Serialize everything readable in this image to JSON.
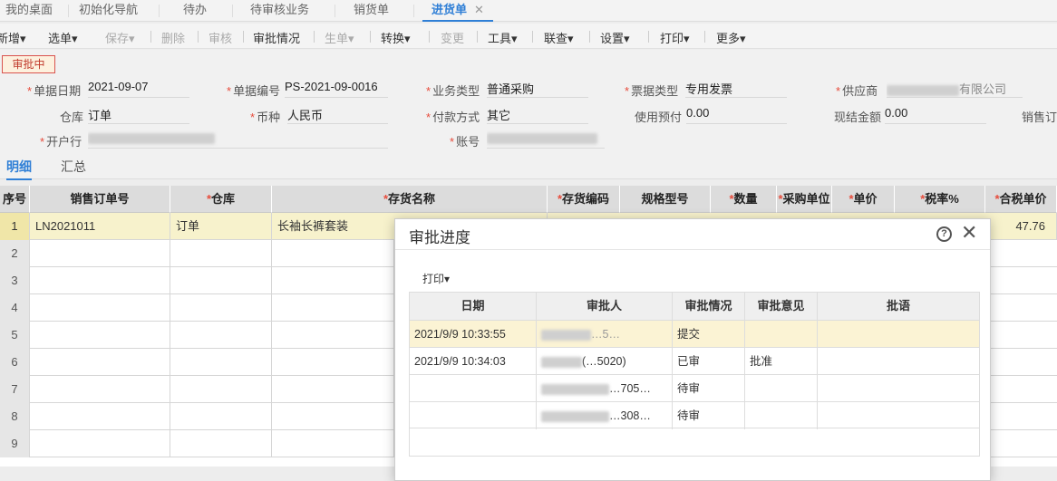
{
  "tabs": [
    {
      "label": "我的桌面"
    },
    {
      "label": "初始化导航"
    },
    {
      "label": "待办"
    },
    {
      "label": "待审核业务"
    },
    {
      "label": "销货单"
    },
    {
      "label": "进货单",
      "close": "✕"
    }
  ],
  "toolbar": {
    "items": [
      "新增",
      "选单",
      "保存",
      "删除",
      "审核",
      "审批情况",
      "生单",
      "转换",
      "变更",
      "工具",
      "联查",
      "设置",
      "打印",
      "更多"
    ],
    "caret": "▾"
  },
  "status_badge": "审批中",
  "form": {
    "date_label": "单据日期",
    "date_value": "2021-09-07",
    "no_label": "单据编号",
    "no_value": "PS-2021-09-0016",
    "biz_label": "业务类型",
    "biz_value": "普通采购",
    "invoice_label": "票据类型",
    "invoice_value": "专用发票",
    "supplier_label": "供应商",
    "supplier_value": "有限公司",
    "warehouse_label": "仓库",
    "warehouse_value": "订单",
    "currency_label": "币种",
    "currency_value": "人民币",
    "pay_label": "付款方式",
    "pay_value": "其它",
    "prepay_label": "使用预付",
    "prepay_value": "0.00",
    "cash_label": "现结金额",
    "cash_value": "0.00",
    "sales_label": "销售订",
    "bank_label": "开户行",
    "account_label": "账号"
  },
  "subtabs": [
    "明细",
    "汇总"
  ],
  "grid": {
    "headers": [
      {
        "label": "序号",
        "req": ""
      },
      {
        "label": "销售订单号",
        "req": ""
      },
      {
        "label": "仓库",
        "req": "*"
      },
      {
        "label": "存货名称",
        "req": "*"
      },
      {
        "label": "存货编码",
        "req": "*"
      },
      {
        "label": "规格型号",
        "req": ""
      },
      {
        "label": "数量",
        "req": "*"
      },
      {
        "label": "采购单位",
        "req": "*"
      },
      {
        "label": "单价",
        "req": "*"
      },
      {
        "label": "税率%",
        "req": "*"
      },
      {
        "label": "合税单价",
        "req": "*"
      }
    ],
    "rows": [
      {
        "no": "1",
        "order": "LN2021011",
        "wh": "订单",
        "name": "长袖长裤套装",
        "price": "47.76"
      },
      {
        "no": "2"
      },
      {
        "no": "3"
      },
      {
        "no": "4"
      },
      {
        "no": "5"
      },
      {
        "no": "6"
      },
      {
        "no": "7"
      },
      {
        "no": "8"
      },
      {
        "no": "9"
      }
    ]
  },
  "modal": {
    "title": "审批进度",
    "help": "?",
    "close": "✕",
    "print": "打印",
    "headers": [
      "日期",
      "审批人",
      "审批情况",
      "审批意见",
      "批语"
    ],
    "rows": [
      {
        "date": "2021/9/9 10:33:55",
        "approver": "…5…",
        "status": "提交",
        "opinion": "",
        "comment": ""
      },
      {
        "date": "2021/9/9 10:34:03",
        "approver": "(…5020)",
        "status": "已审",
        "opinion": "批准",
        "comment": ""
      },
      {
        "date": "",
        "approver": "…705…",
        "status": "待审",
        "opinion": "",
        "comment": ""
      },
      {
        "date": "",
        "approver": "…308…",
        "status": "待审",
        "opinion": "",
        "comment": ""
      }
    ]
  },
  "colors": {
    "accent": "#2f7fd6",
    "required": "#e74c3c",
    "selected_row": "#f7f2cc"
  }
}
